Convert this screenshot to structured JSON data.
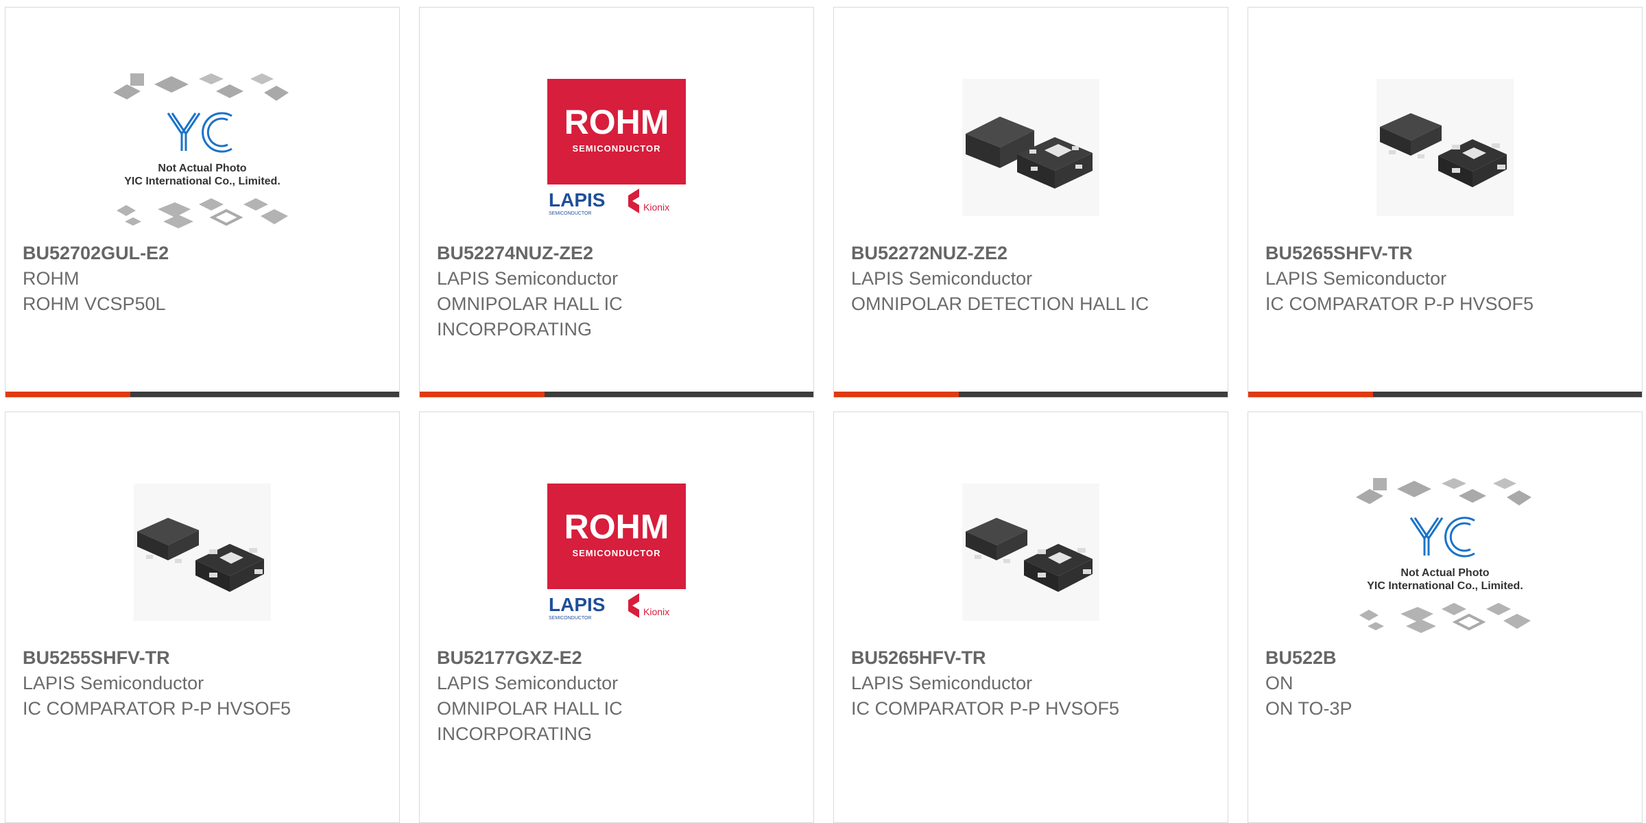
{
  "colors": {
    "accent": "#e03a10",
    "bar": "#3d3d3d",
    "border": "#d9d9d9",
    "rohm_red": "#d71e3c",
    "lapis_blue": "#1e4f9a",
    "yic_blue": "#1a73c9"
  },
  "products": [
    {
      "part_number": "BU52702GUL-E2",
      "manufacturer": "ROHM",
      "description": "ROHM VCSP50L",
      "image": "yic-placeholder",
      "placeholder_line1": "Not Actual Photo",
      "placeholder_line2": "YIC International Co., Limited."
    },
    {
      "part_number": "BU52274NUZ-ZE2",
      "manufacturer": "LAPIS Semiconductor",
      "description": "OMNIPOLAR HALL IC INCORPORATING",
      "image": "rohm-logo",
      "logo_main": "ROHM",
      "logo_sub": "SEMICONDUCTOR",
      "logo_lapis": "LAPIS",
      "logo_lapis_sub": "SEMICONDUCTOR",
      "logo_kionix": "Kionix"
    },
    {
      "part_number": "BU52272NUZ-ZE2",
      "manufacturer": "LAPIS Semiconductor",
      "description": "OMNIPOLAR DETECTION HALL IC",
      "image": "chip-son"
    },
    {
      "part_number": "BU5265SHFV-TR",
      "manufacturer": "LAPIS Semiconductor",
      "description": "IC COMPARATOR P-P HVSOF5",
      "image": "chip-hvsof5"
    },
    {
      "part_number": "BU5255SHFV-TR",
      "manufacturer": "LAPIS Semiconductor",
      "description": "IC COMPARATOR P-P HVSOF5",
      "image": "chip-hvsof5"
    },
    {
      "part_number": "BU52177GXZ-E2",
      "manufacturer": "LAPIS Semiconductor",
      "description": "OMNIPOLAR HALL IC INCORPORATING",
      "image": "rohm-logo",
      "logo_main": "ROHM",
      "logo_sub": "SEMICONDUCTOR",
      "logo_lapis": "LAPIS",
      "logo_lapis_sub": "SEMICONDUCTOR",
      "logo_kionix": "Kionix"
    },
    {
      "part_number": "BU5265HFV-TR",
      "manufacturer": "LAPIS Semiconductor",
      "description": "IC COMPARATOR P-P HVSOF5",
      "image": "chip-hvsof5"
    },
    {
      "part_number": "BU522B",
      "manufacturer": "ON",
      "description": "ON TO-3P",
      "image": "yic-placeholder",
      "placeholder_line1": "Not Actual Photo",
      "placeholder_line2": "YIC International Co., Limited."
    }
  ]
}
